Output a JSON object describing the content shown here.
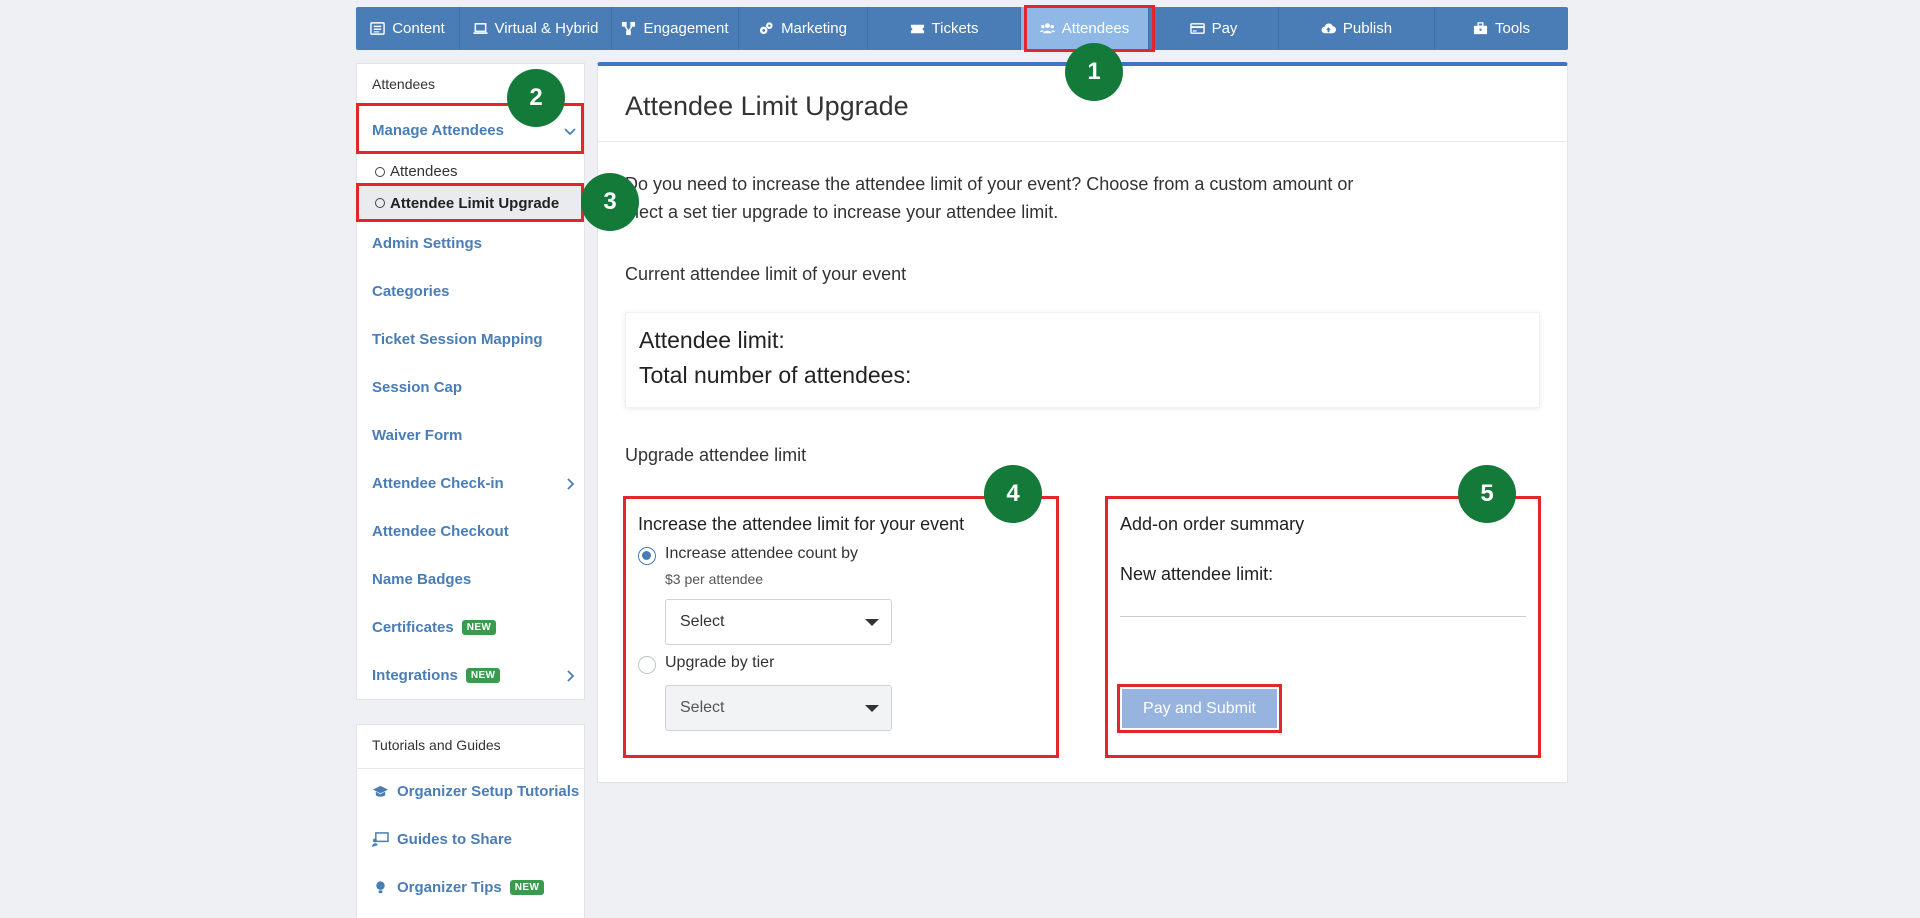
{
  "topnav": {
    "items": [
      {
        "label": "Content",
        "icon": "list-icon"
      },
      {
        "label": "Virtual & Hybrid",
        "icon": "laptop-icon"
      },
      {
        "label": "Engagement",
        "icon": "network-icon"
      },
      {
        "label": "Marketing",
        "icon": "cogs-icon"
      },
      {
        "label": "Tickets",
        "icon": "ticket-icon"
      },
      {
        "label": "Attendees",
        "icon": "users-icon",
        "active": true
      },
      {
        "label": "Pay",
        "icon": "card-icon"
      },
      {
        "label": "Publish",
        "icon": "cloud-upload-icon"
      },
      {
        "label": "Tools",
        "icon": "toolbox-icon"
      }
    ],
    "active_color": "#8fb8e6",
    "bar_color": "#4a7db5"
  },
  "sidebar": {
    "heading": "Attendees",
    "manage": "Manage Attendees",
    "sub_attendees": "Attendees",
    "sub_limit_upgrade": "Attendee Limit Upgrade",
    "links": {
      "admin_settings": "Admin Settings",
      "categories": "Categories",
      "ticket_session_mapping": "Ticket Session Mapping",
      "session_cap": "Session Cap",
      "waiver_form": "Waiver Form",
      "attendee_checkin": "Attendee Check-in",
      "attendee_checkout": "Attendee Checkout",
      "name_badges": "Name Badges",
      "certificates": "Certificates",
      "integrations": "Integrations"
    },
    "badge_new": "NEW"
  },
  "sidebar2": {
    "heading": "Tutorials and Guides",
    "organizer_setup": "Organizer Setup Tutorials",
    "guides_to_share": "Guides to Share",
    "organizer_tips": "Organizer Tips",
    "badge_new": "NEW"
  },
  "main": {
    "title": "Attendee Limit Upgrade",
    "intro_line1": "Do you need to increase the attendee limit of your event? Choose from a custom amount or",
    "intro_line2": "elect a set tier upgrade to increase your attendee limit.",
    "current_label": "Current attendee limit of your event",
    "attendee_limit": "Attendee limit:",
    "total_attendees": "Total number of attendees:",
    "upgrade_label": "Upgrade attendee limit",
    "increase_card": {
      "title": "Increase the attendee limit for your event",
      "option1_label": "Increase attendee count by",
      "option1_sub": "$3 per attendee",
      "select1": "Select",
      "option2_label": "Upgrade by tier",
      "select2": "Select"
    },
    "summary_card": {
      "title": "Add-on order summary",
      "new_limit": "New attendee limit:",
      "pay_button": "Pay and Submit"
    }
  },
  "markers": [
    "1",
    "2",
    "3",
    "4",
    "5"
  ],
  "colors": {
    "highlight": "#e3262b",
    "marker": "#137a3a",
    "link": "#4a7db5"
  }
}
